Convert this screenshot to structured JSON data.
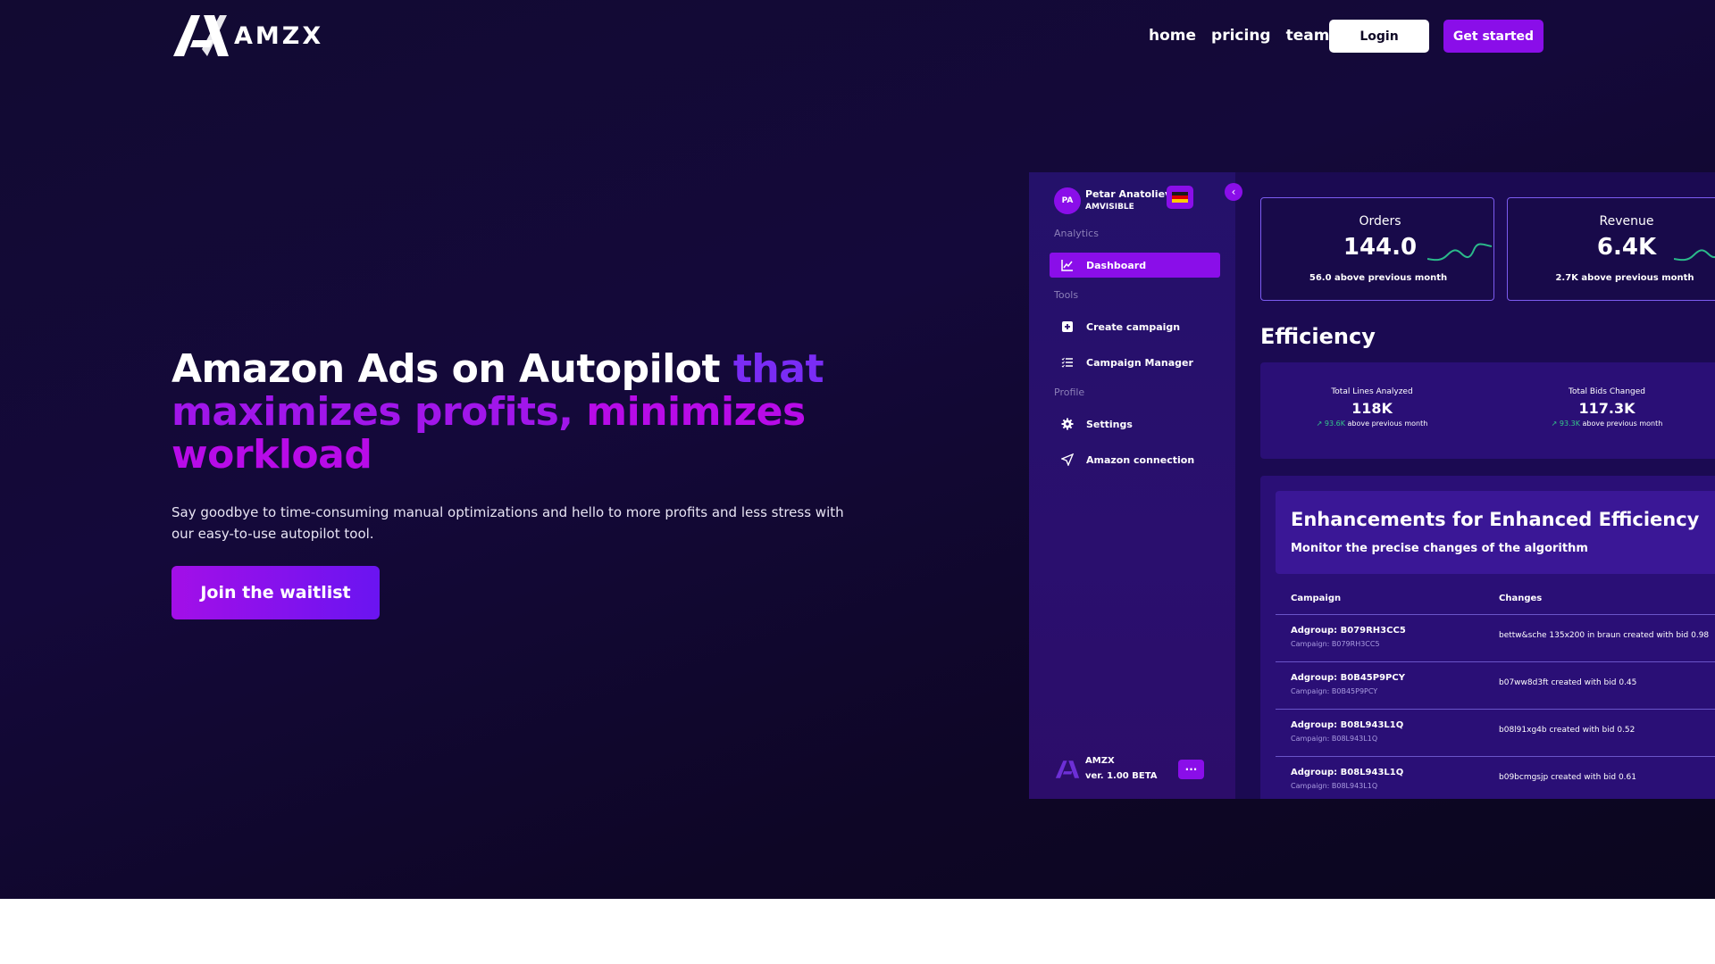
{
  "nav": {
    "brand": "AMZX",
    "links": [
      "home",
      "pricing",
      "team"
    ],
    "login_label": "Login",
    "get_started_label": "Get started"
  },
  "hero": {
    "headline_white": "Amazon Ads on Autopilot ",
    "headline_that": "that",
    "headline_maximizes": "maximizes profits, ",
    "headline_minimizes": "minimizes",
    "headline_workload": "workload",
    "subtext": "Say goodbye to time-consuming manual optimizations and hello to more profits and less stress with our easy-to-use autopilot tool.",
    "cta_label": "Join the waitlist"
  },
  "dashboard": {
    "user": {
      "initials": "PA",
      "name": "Petar Anatoliev",
      "company": "AMVISIBLE"
    },
    "sidebar": {
      "sections": [
        "Analytics",
        "Tools",
        "Profile"
      ],
      "items": [
        {
          "label": "Dashboard",
          "icon": "chart-line-icon",
          "active": true
        },
        {
          "label": "Create campaign",
          "icon": "plus-square-icon"
        },
        {
          "label": "Campaign Manager",
          "icon": "list-check-icon"
        },
        {
          "label": "Settings",
          "icon": "gear-icon"
        },
        {
          "label": "Amazon connection",
          "icon": "send-icon"
        }
      ],
      "footer_name": "AMZX",
      "footer_version": "ver. 1.00 BETA",
      "more_label": "···"
    },
    "kpis": [
      {
        "label": "Orders",
        "value": "144.0",
        "sub": "56.0 above previous month"
      },
      {
        "label": "Revenue",
        "value": "6.4K",
        "sub": "2.7K above previous month"
      }
    ],
    "efficiency": {
      "title": "Efficiency",
      "stats": [
        {
          "label": "Total Lines Analyzed",
          "value": "118K",
          "delta": "93.6K",
          "sub": " above previous month"
        },
        {
          "label": "Total Bids Changed",
          "value": "117.3K",
          "delta": "93.3K",
          "sub": " above previous month"
        }
      ]
    },
    "enhancements": {
      "title": "Enhancements for Enhanced Efficiency",
      "subtitle": "Monitor the precise changes of the algorithm",
      "columns": [
        "Campaign",
        "Changes"
      ],
      "rows": [
        {
          "adgroup": "Adgroup: B079RH3CC5",
          "campaign": "Campaign: B079RH3CC5",
          "change": "bettw&sche 135x200 in braun created with bid 0.98"
        },
        {
          "adgroup": "Adgroup: B0B45P9PCY",
          "campaign": "Campaign: B0B45P9PCY",
          "change": "b07ww8d3ft created with bid 0.45"
        },
        {
          "adgroup": "Adgroup: B08L943L1Q",
          "campaign": "Campaign: B08L943L1Q",
          "change": "b08l91xg4b created with bid 0.52"
        },
        {
          "adgroup": "Adgroup: B08L943L1Q",
          "campaign": "Campaign: B08L943L1Q",
          "change": "b09bcmgsjp created with bid 0.61"
        }
      ]
    }
  },
  "colors": {
    "accent": "#8a0ee9",
    "hero_bg": "#120a32",
    "positive": "#35c98a"
  }
}
